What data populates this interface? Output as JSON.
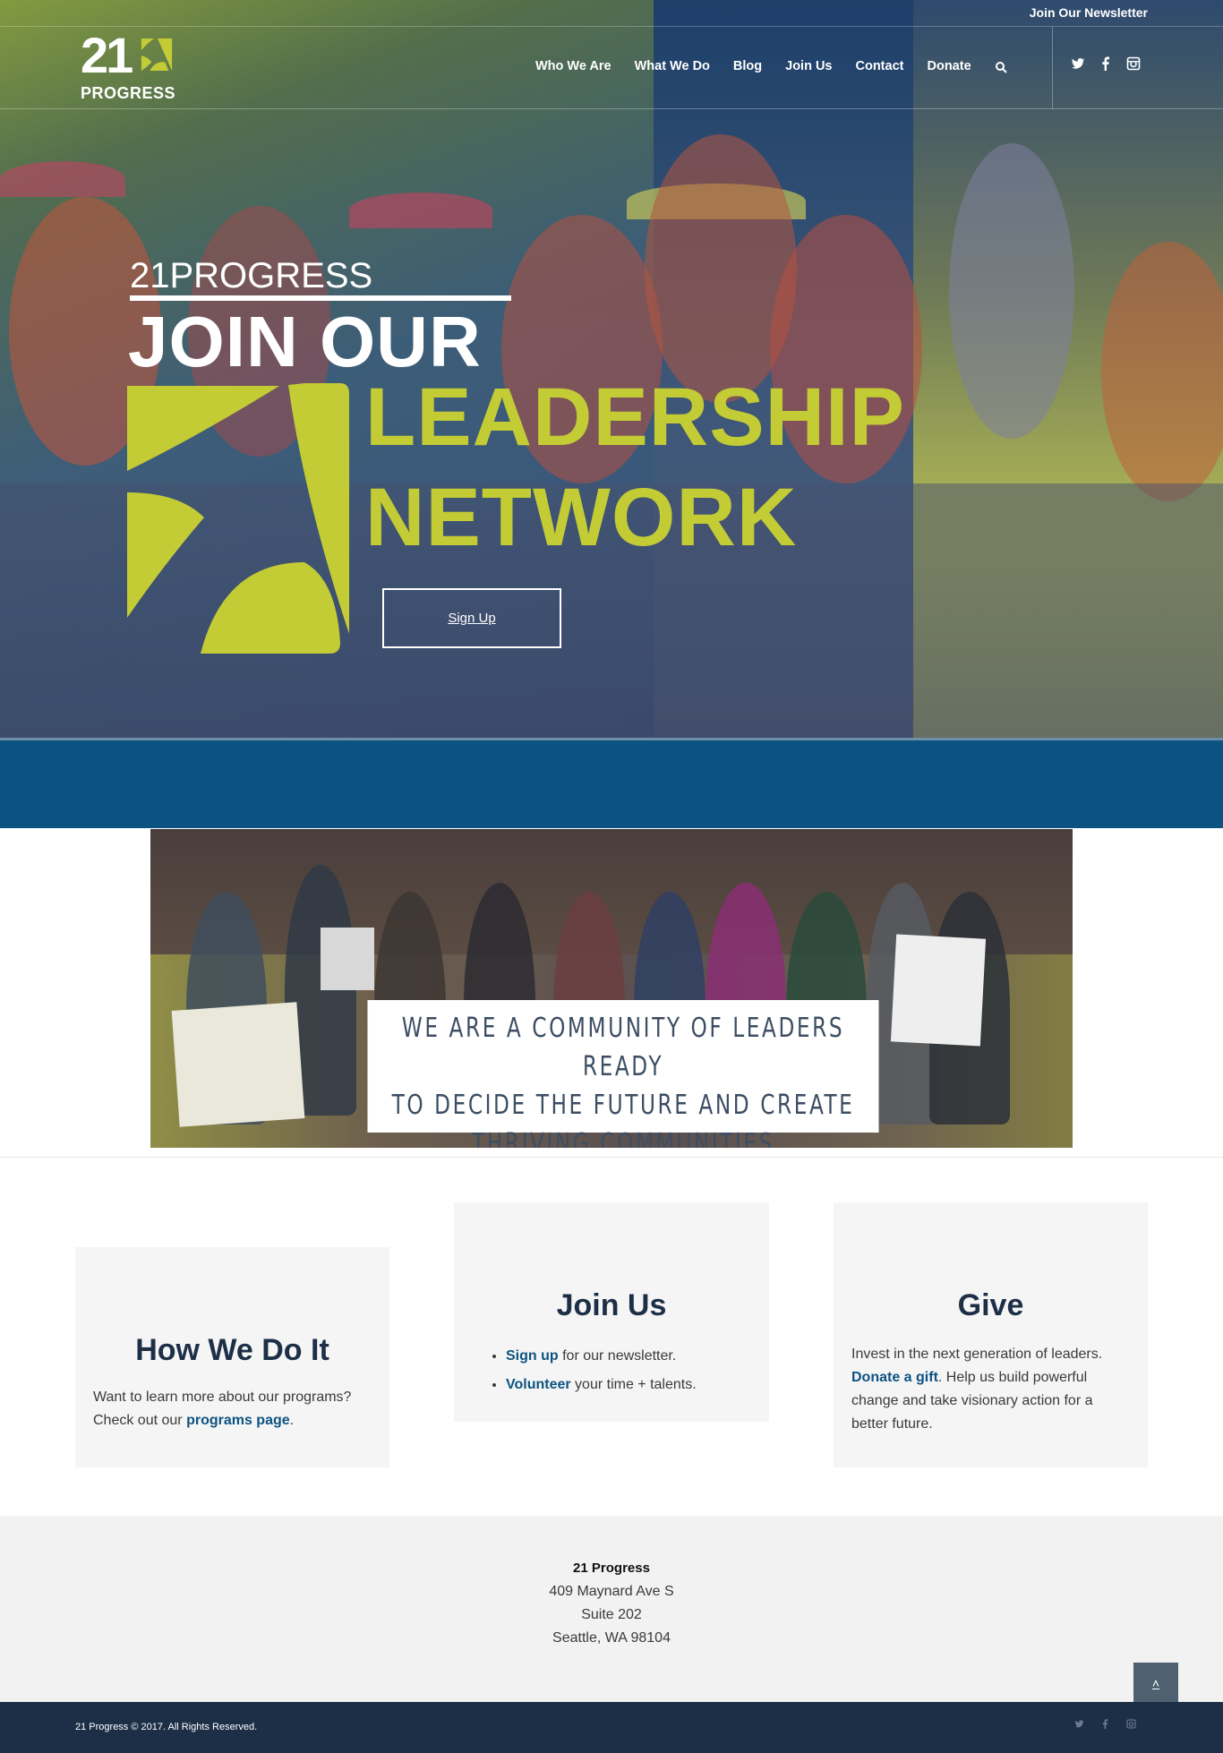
{
  "topbar": {
    "newsletter": "Join Our Newsletter"
  },
  "nav": {
    "logo_number": "21",
    "logo_word": "PROGRESS",
    "items": [
      {
        "label": "Who We Are"
      },
      {
        "label": "What We Do"
      },
      {
        "label": "Blog"
      },
      {
        "label": "Join Us"
      },
      {
        "label": "Contact"
      },
      {
        "label": "Donate"
      }
    ],
    "search_icon": "search-icon",
    "social": [
      "twitter-icon",
      "facebook-icon",
      "instagram-icon"
    ]
  },
  "hero": {
    "subtitle": "21PROGRESS",
    "headline": "JOIN OUR",
    "highlight_1": "LEADERSHIP",
    "highlight_2": "NETWORK",
    "button": "Sign Up",
    "accent_color": "#c3cc35"
  },
  "community": {
    "quote_1": "WE ARE A COMMUNITY OF LEADERS READY",
    "quote_2": "TO DECIDE THE FUTURE AND CREATE",
    "quote_3": "THRIVING COMMUNITIES"
  },
  "cards": {
    "how": {
      "title": "How We Do It",
      "text_1": "Want to learn more about our programs? Check out our ",
      "link": "programs page",
      "text_2": "."
    },
    "join": {
      "title": "Join Us",
      "items": [
        {
          "link": "Sign up",
          "text": " for our newsletter."
        },
        {
          "link": "Volunteer",
          "text": " your time + talents."
        }
      ]
    },
    "give": {
      "title": "Give",
      "text_1": "Invest in the next generation of leaders. ",
      "link": "Donate a gift",
      "text_2": ". Help us build powerful change and take visionary action for a better future."
    }
  },
  "address": {
    "name": "21 Progress",
    "line_1": "409 Maynard Ave S",
    "line_2": "Suite 202",
    "line_3": "Seattle, WA 98104"
  },
  "footer": {
    "copyright": "21 Progress © 2017. All Rights Reserved.",
    "to_top": "˄"
  },
  "colors": {
    "brand_blue": "#0d5381",
    "navy": "#1d2f47",
    "lime": "#c3cc35"
  }
}
